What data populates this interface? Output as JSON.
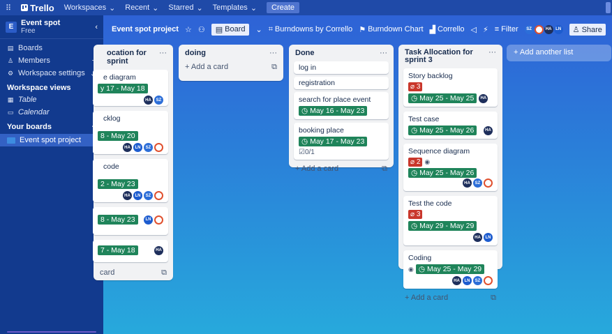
{
  "topnav": {
    "grid_icon": "apps-grid-icon",
    "logo": "Trello",
    "menus": [
      "Workspaces",
      "Recent",
      "Starred",
      "Templates"
    ],
    "create": "Create"
  },
  "sidebar": {
    "workspace_initial": "E",
    "workspace_name": "Event spot",
    "workspace_plan": "Free",
    "collapse": "‹",
    "items": [
      {
        "icon": "▤",
        "label": "Boards",
        "tail": ""
      },
      {
        "icon": "♙",
        "label": "Members",
        "tail": "+"
      },
      {
        "icon": "⚙",
        "label": "Workspace settings",
        "tail": "⌄"
      }
    ],
    "views_heading": "Workspace views",
    "views": [
      {
        "icon": "▦",
        "label": "Table"
      },
      {
        "icon": "▭",
        "label": "Calendar"
      }
    ],
    "boards_heading": "Your boards",
    "boards_add": "+",
    "board_name": "Event spot project"
  },
  "boardbar": {
    "title": "Event spot project",
    "star": "☆",
    "view_label": "Board",
    "burndowns": "Burndowns by Corrello",
    "burndown_chart": "Burndown Chart",
    "corrello": "Corrello",
    "filter": "Filter",
    "share": "Share",
    "avatars": [
      "SZ",
      "",
      "HA",
      "LN"
    ]
  },
  "lists": [
    {
      "title": "ocation for sprint",
      "cards": [
        {
          "title": "e diagram",
          "due": "y 17 - May 18",
          "members": [
            "HA",
            "SZ"
          ]
        },
        {
          "title": "cklog",
          "due": "8 - May 20",
          "members": [
            "HA",
            "LN",
            "SZ",
            ""
          ]
        },
        {
          "title": "code",
          "due": "2 - May 23",
          "members": [
            "HA",
            "LN",
            "SZ",
            ""
          ]
        },
        {
          "title": "",
          "due": "8 - May 23",
          "members": [
            "LN",
            ""
          ]
        },
        {
          "title": "",
          "due": "7 - May 18",
          "members": [
            "HA"
          ]
        }
      ],
      "add": "card"
    },
    {
      "title": "doing",
      "cards": [],
      "add": "+ Add a card"
    },
    {
      "title": "Done",
      "cards": [
        {
          "title": "log in"
        },
        {
          "title": "registration"
        },
        {
          "title": "search for place event",
          "due": "May 16 - May 23"
        },
        {
          "title": "booking place",
          "due": "May 17 - May 23",
          "checklist": "0/1"
        }
      ],
      "add": "+ Add a card"
    },
    {
      "title": "Task Allocation for sprint 3",
      "cards": [
        {
          "title": "Story backlog",
          "red": "3",
          "due": "May 25 - May 25",
          "members": [
            "HA"
          ]
        },
        {
          "title": "Test case",
          "due": "May 25 - May 26",
          "members": [
            "HA"
          ]
        },
        {
          "title": "Sequence diagram",
          "red": "2",
          "due": "May 25 - May 26",
          "members": [
            "HA",
            "SZ",
            ""
          ]
        },
        {
          "title": "Test the code",
          "red": "3",
          "due": "May 29 - May 29",
          "members": [
            "HA",
            "LN"
          ]
        },
        {
          "title": "Coding",
          "due": "May 25 - May 29",
          "members": [
            "HA",
            "LN",
            "SZ",
            ""
          ]
        }
      ],
      "add": "+ Add a card"
    }
  ],
  "add_list": "+ Add another list"
}
